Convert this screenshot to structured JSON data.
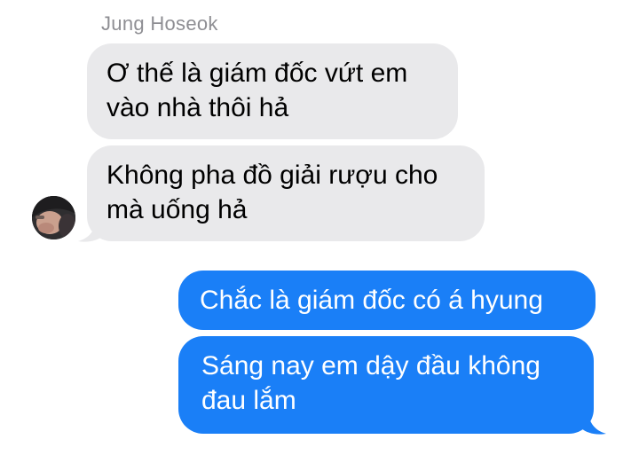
{
  "conversation": {
    "sender_name": "Jung Hoseok",
    "messages": [
      {
        "direction": "incoming",
        "text": "Ơ thế là giám đốc vứt em\nvào nhà thôi hả"
      },
      {
        "direction": "incoming",
        "text": "Không pha đồ giải rượu cho\nmà uống hả"
      },
      {
        "direction": "outgoing",
        "text": "Chắc là giám đốc có á hyung"
      },
      {
        "direction": "outgoing",
        "text": "Sáng nay em dậy đầu không\nđau lắm"
      }
    ]
  },
  "colors": {
    "incoming_bubble": "#e9e9eb",
    "outgoing_bubble": "#1a7ff7",
    "sender_name": "#8e8e93"
  },
  "icons": {
    "avatar": "contact-avatar-photo"
  }
}
